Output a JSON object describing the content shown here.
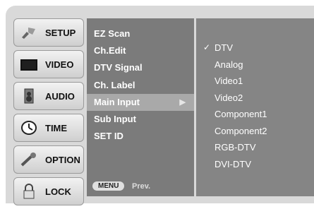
{
  "left_menu": [
    {
      "label": "SETUP",
      "icon": "setup-icon",
      "active": true
    },
    {
      "label": "VIDEO",
      "icon": "video-icon"
    },
    {
      "label": "AUDIO",
      "icon": "audio-icon"
    },
    {
      "label": "TIME",
      "icon": "time-icon"
    },
    {
      "label": "OPTION",
      "icon": "option-icon"
    },
    {
      "label": "LOCK",
      "icon": "lock-icon"
    }
  ],
  "submenu": {
    "items": [
      {
        "label": "EZ Scan"
      },
      {
        "label": "Ch.Edit"
      },
      {
        "label": "DTV Signal"
      },
      {
        "label": "Ch. Label"
      },
      {
        "label": "Main Input",
        "selected": true,
        "arrow": "▶"
      },
      {
        "label": "Sub Input"
      },
      {
        "label": "SET ID"
      }
    ],
    "hint": {
      "key": "MENU",
      "text": "Prev."
    }
  },
  "main_input_options": {
    "selected": "DTV",
    "check_symbol": "✓",
    "items": [
      "DTV",
      "Analog",
      "Video1",
      "Video2",
      "Component1",
      "Component2",
      "RGB-DTV",
      "DVI-DTV"
    ]
  }
}
